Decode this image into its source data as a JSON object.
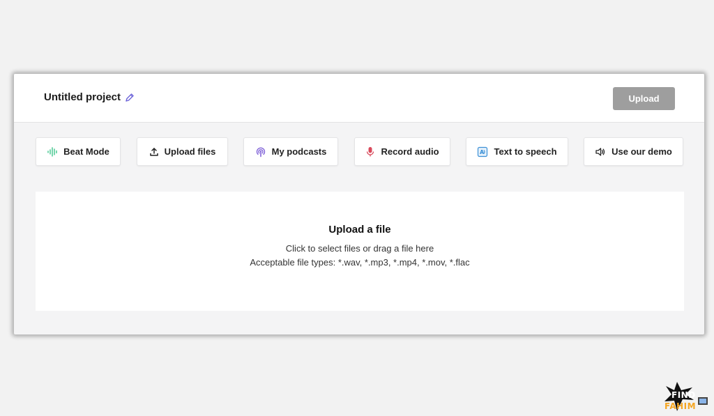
{
  "header": {
    "project_title": "Untitled project",
    "edit_icon": "pencil-icon",
    "upload_label": "Upload"
  },
  "tools": [
    {
      "label": "Beat Mode",
      "icon": "waveform-icon",
      "icon_color": "#3cc48a"
    },
    {
      "label": "Upload files",
      "icon": "upload-icon",
      "icon_color": "#222222"
    },
    {
      "label": "My podcasts",
      "icon": "podcast-icon",
      "icon_color": "#7b5cd6"
    },
    {
      "label": "Record audio",
      "icon": "microphone-icon",
      "icon_color": "#d94a5c"
    },
    {
      "label": "Text to speech",
      "icon": "text-to-speech-icon",
      "icon_color": "#3a8fd6"
    },
    {
      "label": "Use our demo",
      "icon": "speaker-icon",
      "icon_color": "#222222"
    }
  ],
  "dropzone": {
    "title": "Upload a file",
    "instruction": "Click to select files or drag a file here",
    "file_types": "Acceptable file types: *.wav, *.mp3, *.mp4, *.mov, *.flac"
  },
  "watermark": {
    "line1": "FIND",
    "line2": "FAHIM"
  },
  "colors": {
    "upload_button_bg": "#9e9e9e",
    "pencil": "#6c63d9"
  }
}
